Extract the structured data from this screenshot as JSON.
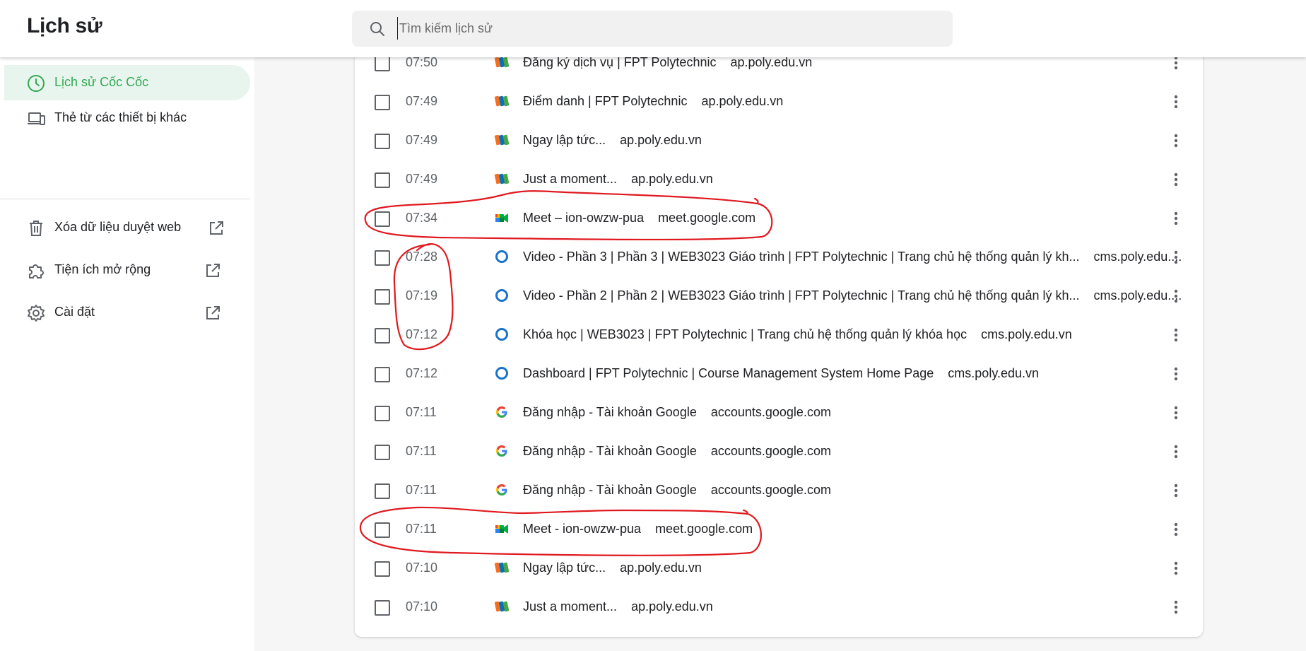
{
  "header": {
    "title": "Lịch sử",
    "search_placeholder": "Tìm kiếm lịch sử"
  },
  "sidebar": {
    "items": [
      {
        "label": "Lịch sử Cốc Cốc",
        "icon": "clock-icon",
        "active": true
      },
      {
        "label": "Thẻ từ các thiết bị khác",
        "icon": "devices-icon",
        "active": false
      }
    ],
    "links": [
      {
        "label": "Xóa dữ liệu duyệt web",
        "icon": "trash-icon"
      },
      {
        "label": "Tiện ích mở rộng",
        "icon": "puzzle-icon"
      },
      {
        "label": "Cài đặt",
        "icon": "gear-icon"
      }
    ]
  },
  "history": [
    {
      "time": "07:50",
      "icon": "fpt-favicon",
      "title": "Đăng ký dịch vụ | FPT Polytechnic",
      "domain": "ap.poly.edu.vn"
    },
    {
      "time": "07:49",
      "icon": "fpt-favicon",
      "title": "Điểm danh | FPT Polytechnic",
      "domain": "ap.poly.edu.vn"
    },
    {
      "time": "07:49",
      "icon": "fpt-favicon",
      "title": "Ngay lập tức...",
      "domain": "ap.poly.edu.vn"
    },
    {
      "time": "07:49",
      "icon": "fpt-favicon",
      "title": "Just a moment...",
      "domain": "ap.poly.edu.vn"
    },
    {
      "time": "07:34",
      "icon": "google-meet-favicon",
      "title": "Meet – ion-owzw-pua",
      "domain": "meet.google.com"
    },
    {
      "time": "07:28",
      "icon": "cms-favicon",
      "title": "Video - Phần 3 | Phần 3 | WEB3023 Giáo trình | FPT Polytechnic | Trang chủ hệ thống quản lý kh...",
      "domain": "cms.poly.edu...."
    },
    {
      "time": "07:19",
      "icon": "cms-favicon",
      "title": "Video - Phần 2 | Phần 2 | WEB3023 Giáo trình | FPT Polytechnic | Trang chủ hệ thống quản lý kh...",
      "domain": "cms.poly.edu...."
    },
    {
      "time": "07:12",
      "icon": "cms-favicon",
      "title": "Khóa học | WEB3023 | FPT Polytechnic | Trang chủ hệ thống quản lý khóa học",
      "domain": "cms.poly.edu.vn"
    },
    {
      "time": "07:12",
      "icon": "cms-favicon",
      "title": "Dashboard | FPT Polytechnic | Course Management System Home Page",
      "domain": "cms.poly.edu.vn"
    },
    {
      "time": "07:11",
      "icon": "google-favicon",
      "title": "Đăng nhập - Tài khoản Google",
      "domain": "accounts.google.com"
    },
    {
      "time": "07:11",
      "icon": "google-favicon",
      "title": "Đăng nhập - Tài khoản Google",
      "domain": "accounts.google.com"
    },
    {
      "time": "07:11",
      "icon": "google-favicon",
      "title": "Đăng nhập - Tài khoản Google",
      "domain": "accounts.google.com"
    },
    {
      "time": "07:11",
      "icon": "google-meet-favicon",
      "title": "Meet - ion-owzw-pua",
      "domain": "meet.google.com"
    },
    {
      "time": "07:10",
      "icon": "fpt-favicon",
      "title": "Ngay lập tức...",
      "domain": "ap.poly.edu.vn"
    },
    {
      "time": "07:10",
      "icon": "fpt-favicon",
      "title": "Just a moment...",
      "domain": "ap.poly.edu.vn"
    }
  ],
  "colors": {
    "accent": "#34a853",
    "active_bg": "#e8f5ee",
    "annotation_red": "#e0191f",
    "cms_blue": "#1a73c8"
  }
}
